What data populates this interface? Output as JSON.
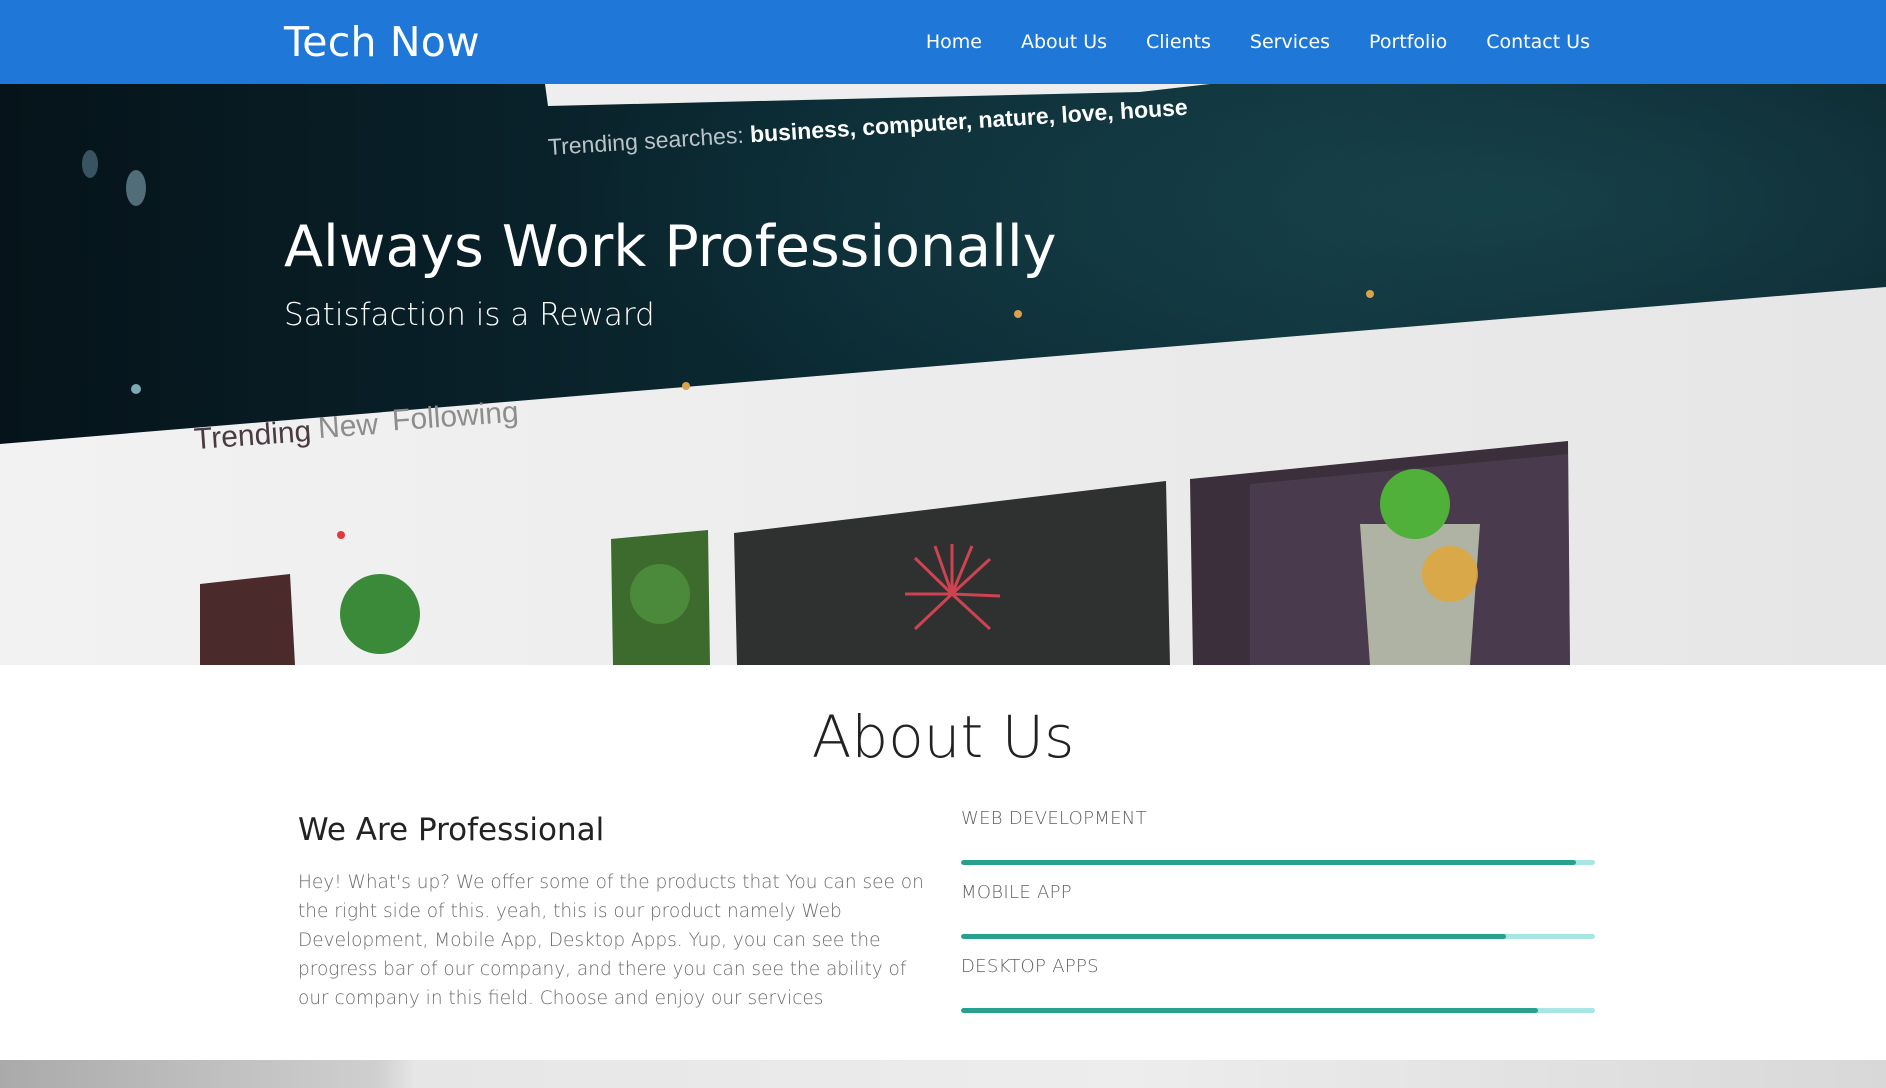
{
  "navbar": {
    "brand": "Tech Now",
    "links": [
      {
        "label": "Home"
      },
      {
        "label": "About Us"
      },
      {
        "label": "Clients"
      },
      {
        "label": "Services"
      },
      {
        "label": "Portfolio"
      },
      {
        "label": "Contact Us"
      }
    ],
    "background_color": "#1f78d7"
  },
  "hero": {
    "title": "Always Work Professionally",
    "subtitle": "Satisfaction is a Reward",
    "background_photo": {
      "trending_label": "Trending searches:",
      "trending_terms": "business, computer, nature, love, house",
      "tabs": [
        "Trending",
        "New",
        "Following"
      ]
    }
  },
  "about": {
    "title": "About Us",
    "subtitle": "We Are Professional",
    "text": "Hey! What's up? We offer some of the products that You can see on the right side of this. yeah, this is our product namely Web Development, Mobile App, Desktop Apps. Yup, you can see the progress bar of our company, and there you can see the ability of our company in this field. Choose and enjoy our services",
    "skills": [
      {
        "label": "WEB DEVELOPMENT",
        "percent": 97
      },
      {
        "label": "MOBILE APP",
        "percent": 86
      },
      {
        "label": "DESKTOP APPS",
        "percent": 91
      }
    ],
    "progress_track_color": "#a8e6e3",
    "progress_fill_color": "#27a08e"
  }
}
